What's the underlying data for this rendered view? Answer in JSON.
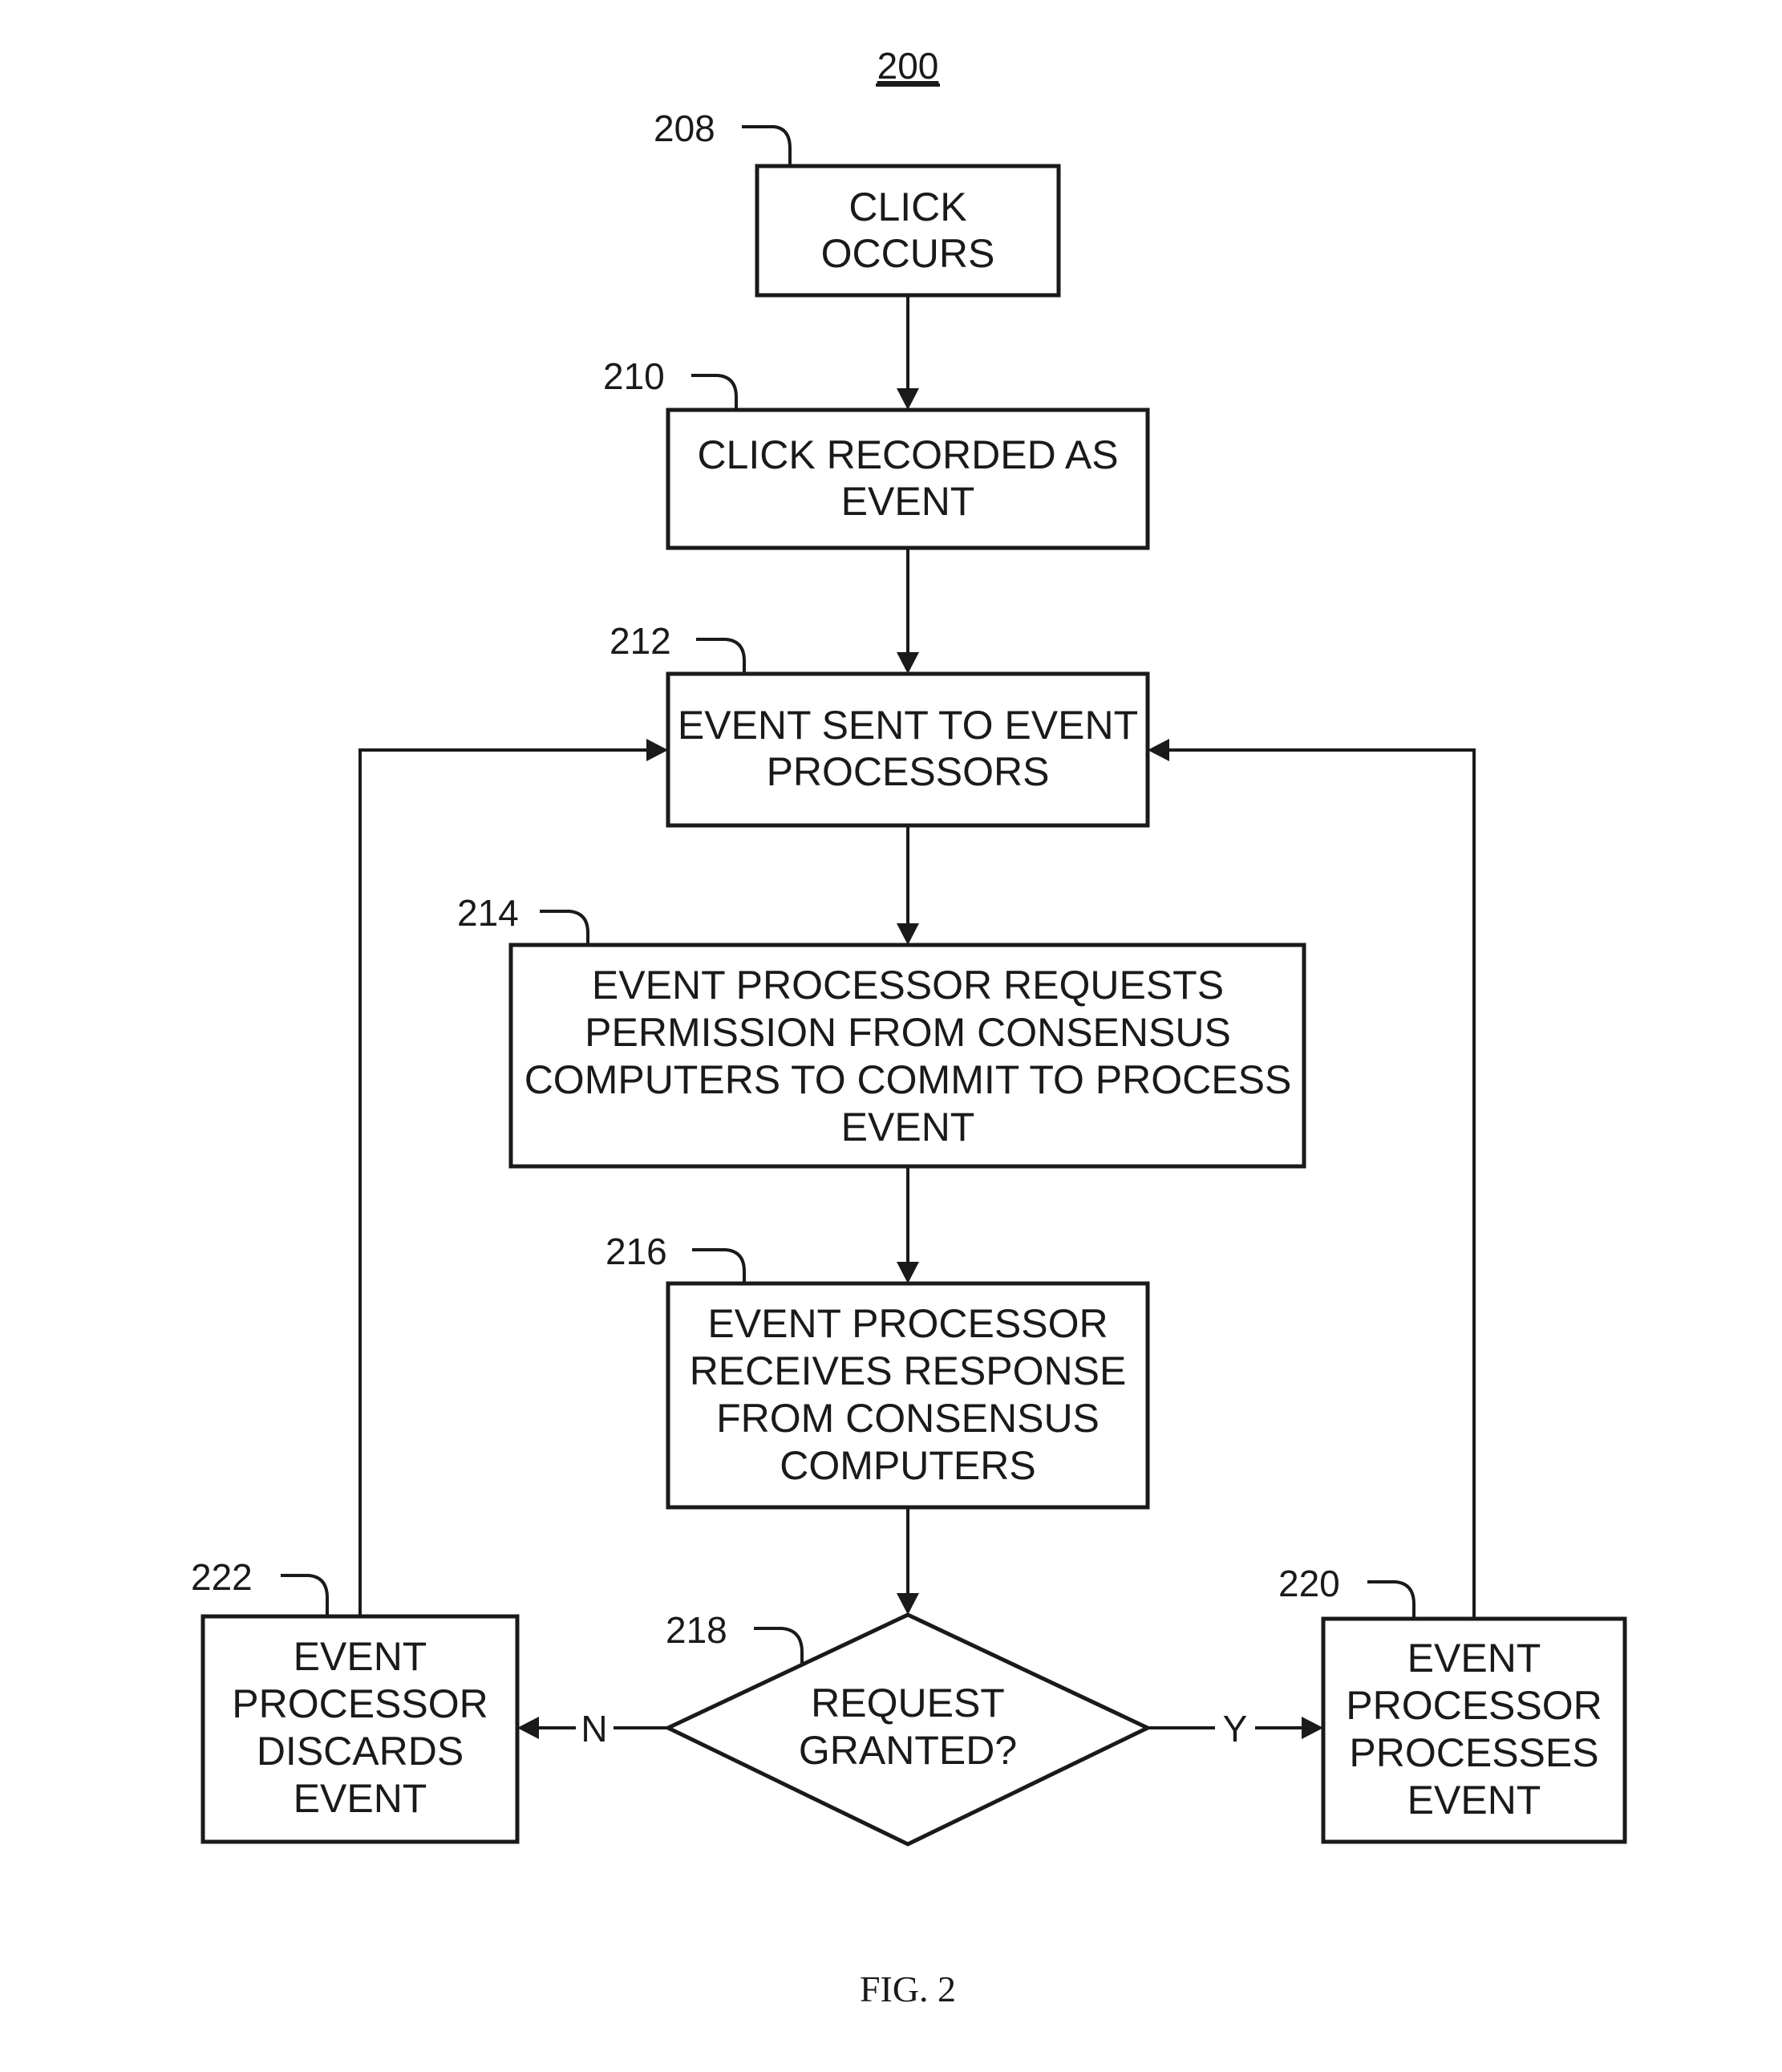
{
  "figure": {
    "number": "200",
    "caption": "FIG. 2"
  },
  "nodes": {
    "n208": {
      "ref": "208",
      "lines": [
        "CLICK",
        "OCCURS"
      ]
    },
    "n210": {
      "ref": "210",
      "lines": [
        "CLICK RECORDED AS",
        "EVENT"
      ]
    },
    "n212": {
      "ref": "212",
      "lines": [
        "EVENT SENT TO EVENT",
        "PROCESSORS"
      ]
    },
    "n214": {
      "ref": "214",
      "lines": [
        "EVENT PROCESSOR REQUESTS",
        "PERMISSION FROM CONSENSUS",
        "COMPUTERS TO COMMIT TO PROCESS",
        "EVENT"
      ]
    },
    "n216": {
      "ref": "216",
      "lines": [
        "EVENT PROCESSOR",
        "RECEIVES RESPONSE",
        "FROM CONSENSUS",
        "COMPUTERS"
      ]
    },
    "n218": {
      "ref": "218",
      "lines": [
        "REQUEST",
        "GRANTED?"
      ]
    },
    "n220": {
      "ref": "220",
      "lines": [
        "EVENT",
        "PROCESSOR",
        "PROCESSES",
        "EVENT"
      ]
    },
    "n222": {
      "ref": "222",
      "lines": [
        "EVENT",
        "PROCESSOR",
        "DISCARDS",
        "EVENT"
      ]
    }
  },
  "edges": {
    "no_label": "N",
    "yes_label": "Y"
  }
}
